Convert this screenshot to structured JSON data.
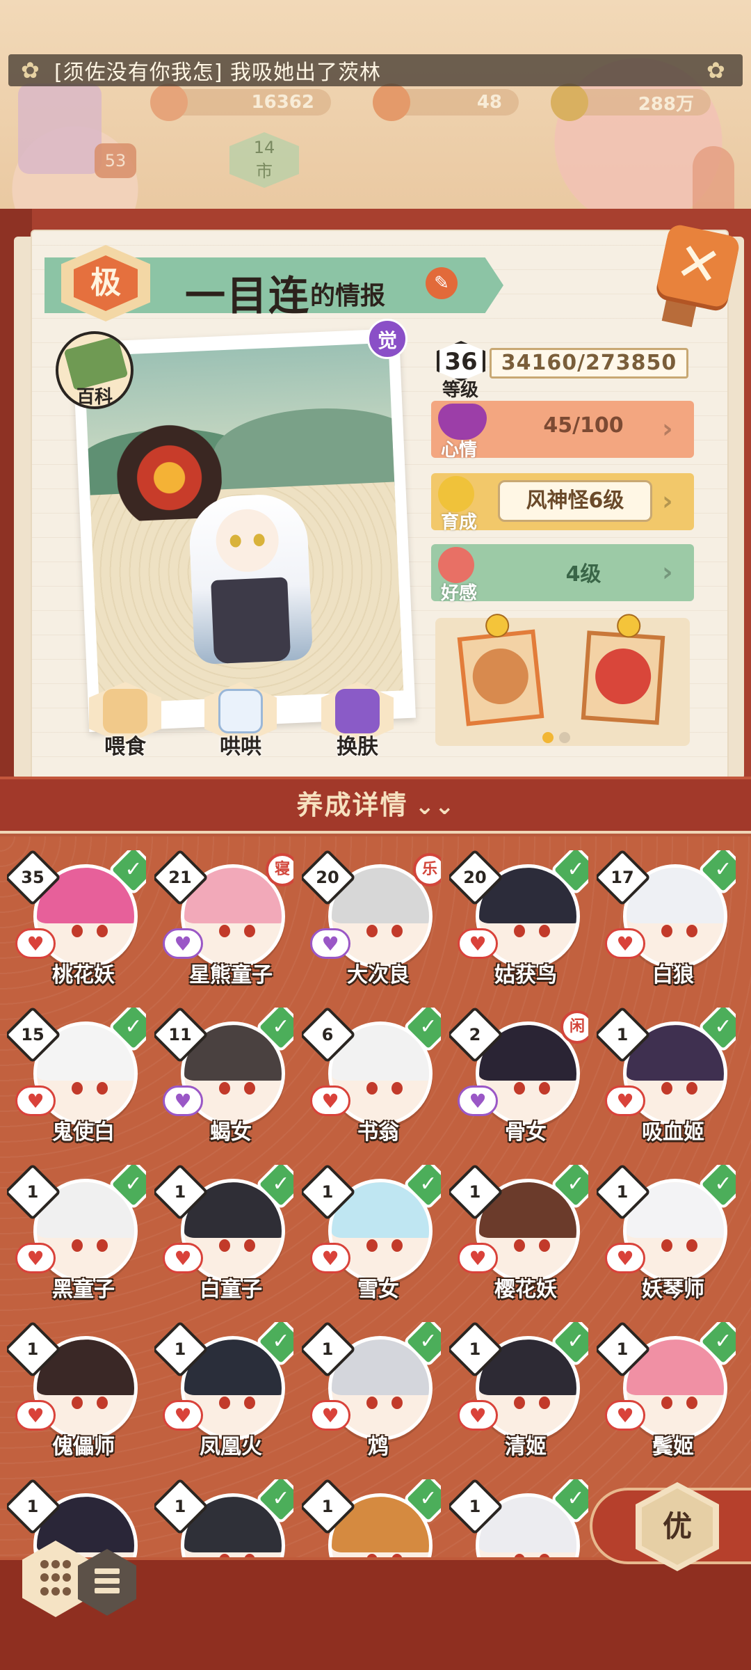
{
  "hud": {
    "chat_message": "[须佐没有你我怎] 我吸她出了茨林",
    "gold": "16362",
    "jade": "48",
    "coins": "288万",
    "player_level": "53",
    "city_label": "14\n市"
  },
  "info": {
    "grade": "极",
    "name": "一目连",
    "name_suffix": "的情报",
    "awaken_badge": "觉",
    "encyclopedia_label": "百科",
    "level": "36",
    "level_label": "等级",
    "exp": "34160/273850",
    "mood_label": "心情",
    "mood_value": "45/100",
    "growth_label": "育成",
    "growth_value": "风神怪6级",
    "favor_label": "好感",
    "favor_value": "4级",
    "gift_page": 1,
    "gift_pages": 2,
    "actions": [
      {
        "label": "喂食"
      },
      {
        "label": "哄哄"
      },
      {
        "label": "换肤"
      }
    ]
  },
  "detail_header": "养成详情",
  "cards": [
    {
      "name": "桃花妖",
      "level": "35",
      "status": "check",
      "heart": "red",
      "hair": "#e7609a"
    },
    {
      "name": "星熊童子",
      "level": "21",
      "status": "badge",
      "badge_text": "寝",
      "heart": "purple",
      "hair": "#f2a9b9"
    },
    {
      "name": "大次良",
      "level": "20",
      "status": "badge",
      "badge_text": "乐",
      "heart": "purple",
      "hair": "#d7d7d7"
    },
    {
      "name": "姑获鸟",
      "level": "20",
      "status": "check",
      "heart": "red",
      "hair": "#2c2c3a"
    },
    {
      "name": "白狼",
      "level": "17",
      "status": "check",
      "heart": "red",
      "hair": "#eef0f4"
    },
    {
      "name": "鬼使白",
      "level": "15",
      "status": "check",
      "heart": "red",
      "hair": "#f4f4f4"
    },
    {
      "name": "蝎女",
      "level": "11",
      "status": "check",
      "heart": "purple",
      "hair": "#4a4140"
    },
    {
      "name": "书翁",
      "level": "6",
      "status": "check",
      "heart": "red",
      "hair": "#f2f2f2"
    },
    {
      "name": "骨女",
      "level": "2",
      "status": "badge",
      "badge_text": "闲",
      "heart": "purple",
      "hair": "#2a2434"
    },
    {
      "name": "吸血姬",
      "level": "1",
      "status": "check",
      "heart": "red",
      "hair": "#3f3050"
    },
    {
      "name": "黑童子",
      "level": "1",
      "status": "check",
      "heart": "red",
      "hair": "#f0f0f0"
    },
    {
      "name": "白童子",
      "level": "1",
      "status": "check",
      "heart": "red",
      "hair": "#2f2e36"
    },
    {
      "name": "雪女",
      "level": "1",
      "status": "check",
      "heart": "red",
      "hair": "#bfe6f2"
    },
    {
      "name": "樱花妖",
      "level": "1",
      "status": "check",
      "heart": "red",
      "hair": "#6b3b2b"
    },
    {
      "name": "妖琴师",
      "level": "1",
      "status": "check",
      "heart": "red",
      "hair": "#f3f3f5"
    },
    {
      "name": "傀儡师",
      "level": "1",
      "status": "none",
      "heart": "red",
      "hair": "#3a2826"
    },
    {
      "name": "凤凰火",
      "level": "1",
      "status": "check",
      "heart": "red",
      "hair": "#2a2e3a"
    },
    {
      "name": "鸩",
      "level": "1",
      "status": "check",
      "heart": "red",
      "hair": "#d4d6dc"
    },
    {
      "name": "清姬",
      "level": "1",
      "status": "check",
      "heart": "red",
      "hair": "#2d2a34"
    },
    {
      "name": "鬓姬",
      "level": "1",
      "status": "check",
      "heart": "red",
      "hair": "#f090a4"
    },
    {
      "name": "",
      "level": "1",
      "status": "none",
      "heart": "none",
      "hair": "#2a2638"
    },
    {
      "name": "",
      "level": "1",
      "status": "check",
      "heart": "none",
      "hair": "#2f3038"
    },
    {
      "name": "",
      "level": "1",
      "status": "check",
      "heart": "none",
      "hair": "#d58a40"
    },
    {
      "name": "",
      "level": "1",
      "status": "check",
      "heart": "none",
      "hair": "#ececf0"
    }
  ],
  "priority_button": "优",
  "colors": {
    "accent_orange": "#e8823c",
    "check_green": "#4cae5a",
    "heart_red": "#d9423a",
    "heart_purple": "#9a57c6",
    "panel_red": "#a2392a"
  }
}
